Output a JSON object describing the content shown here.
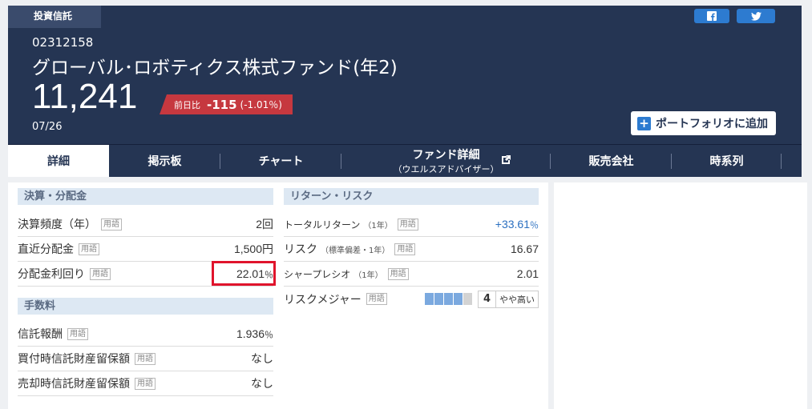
{
  "header": {
    "category": "投資信託",
    "fund_code": "02312158",
    "fund_name": "グローバル･ロボティクス株式ファンド(年2)",
    "price": "11,241",
    "change_label": "前日比",
    "change_value": "-115",
    "change_pct": "(-1.01％)",
    "date": "07/26",
    "portfolio_button": "ポートフォリオに追加",
    "social": [
      "facebook-icon",
      "twitter-icon"
    ],
    "colors": {
      "navy": "#253553",
      "down": "#c6383f",
      "accent": "#2d7bd0"
    }
  },
  "tabs": [
    {
      "label": "詳細",
      "active": true
    },
    {
      "label": "掲示板"
    },
    {
      "label": "チャート"
    },
    {
      "label": "ファンド詳細",
      "sub": "（ウエルスアドバイザー）"
    },
    {
      "label": "販売会社"
    },
    {
      "label": "時系列"
    }
  ],
  "settlement": {
    "title": "決算・分配金",
    "rows": [
      {
        "label": "決算頻度（年）",
        "tag": "用語",
        "value": "2回"
      },
      {
        "label": "直近分配金",
        "tag": "用語",
        "value": "1,500円"
      },
      {
        "label": "分配金利回り",
        "tag": "用語",
        "value": "22.01",
        "unit": "％"
      }
    ]
  },
  "fees": {
    "title": "手数料",
    "rows": [
      {
        "label": "信託報酬",
        "tag": "用語",
        "value": "1.936",
        "unit": "％"
      },
      {
        "label": "買付時信託財産留保額",
        "tag": "用語",
        "value": "なし"
      },
      {
        "label": "売却時信託財産留保額",
        "tag": "用語",
        "value": "なし"
      }
    ]
  },
  "return_risk": {
    "title": "リターン・リスク",
    "total_return": {
      "label": "トータルリターン",
      "note": "（1年）",
      "tag": "用語",
      "value": "+33.61",
      "unit": "％"
    },
    "risk": {
      "label": "リスク",
      "note": "（標準偏差・1年）",
      "tag": "用語",
      "value": "16.67"
    },
    "sharpe": {
      "label": "シャープレシオ",
      "note": "（1年）",
      "tag": "用語",
      "value": "2.01"
    },
    "risk_measure": {
      "label": "リスクメジャー",
      "tag": "用語",
      "level": "4",
      "level_text": "やや高い",
      "segments_on": 4,
      "segments_total": 5
    }
  }
}
